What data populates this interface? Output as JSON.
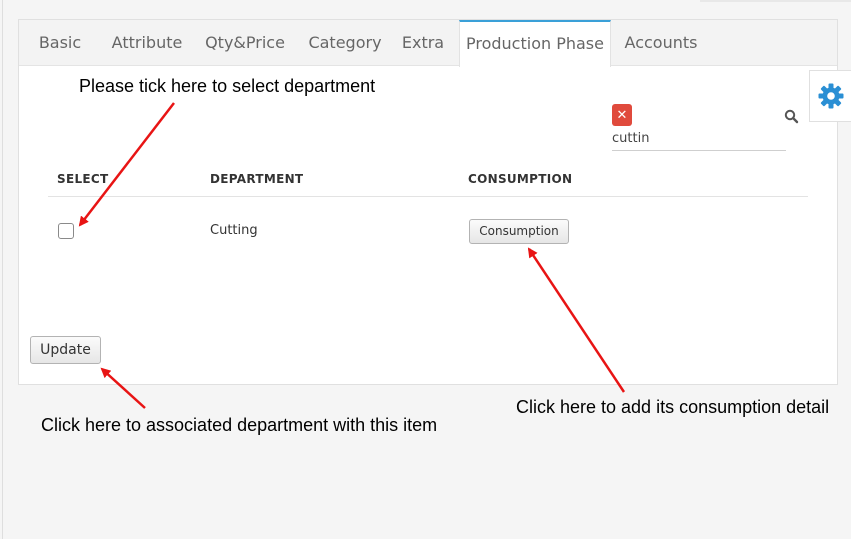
{
  "tabs": [
    {
      "label": "Basic"
    },
    {
      "label": "Attribute"
    },
    {
      "label": "Qty&Price"
    },
    {
      "label": "Category"
    },
    {
      "label": "Extra"
    },
    {
      "label": "Production Phase",
      "active": true
    },
    {
      "label": "Accounts"
    }
  ],
  "search": {
    "value": "cuttin",
    "clear_icon": "close-icon",
    "search_icon": "search-icon"
  },
  "table": {
    "headers": [
      "SELECT",
      "DEPARTMENT",
      "CONSUMPTION"
    ],
    "rows": [
      {
        "selected": false,
        "department": "Cutting",
        "consumption_button": "Consumption"
      }
    ]
  },
  "update_button": "Update",
  "annotations": {
    "select": "Please tick here to select department",
    "update": "Click here to associated department with this item",
    "consumption": "Click here to add its consumption detail"
  },
  "colors": {
    "accent": "#3aa0d8",
    "arrow": "#e81414",
    "clear": "#e04a3c"
  }
}
